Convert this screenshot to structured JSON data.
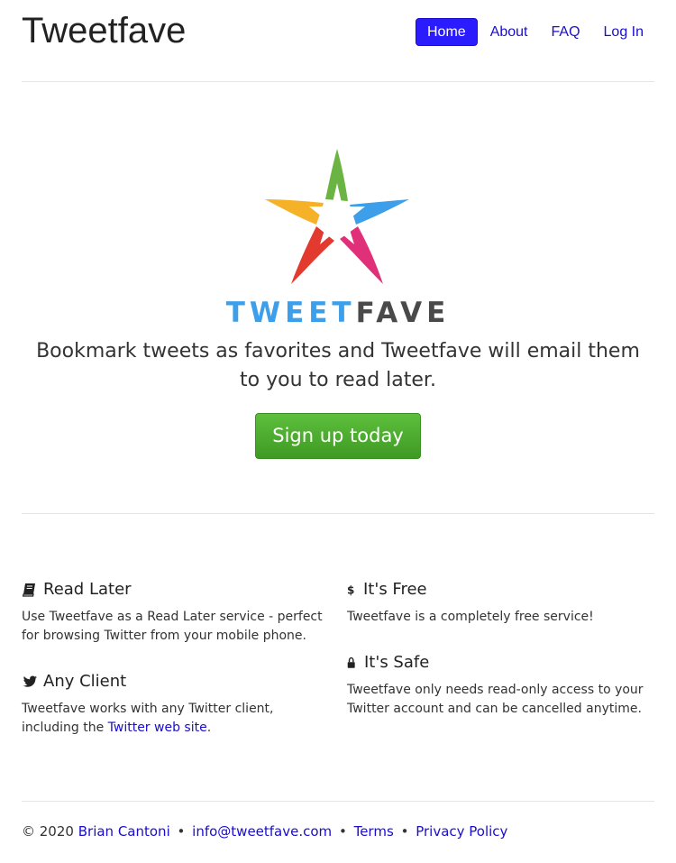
{
  "header": {
    "brand": "Tweetfave",
    "nav": [
      {
        "label": "Home",
        "active": true
      },
      {
        "label": "About",
        "active": false
      },
      {
        "label": "FAQ",
        "active": false
      },
      {
        "label": "Log In",
        "active": false
      }
    ]
  },
  "hero": {
    "logo_icon": "multicolor-star-icon",
    "wordmark_part1": "TWEET",
    "wordmark_part2": "FAVE",
    "tagline": "Bookmark tweets as favorites and Tweetfave will email them to you to read later.",
    "cta_label": "Sign up today"
  },
  "features": {
    "read_later": {
      "icon": "book-icon",
      "title": "Read Later",
      "text": "Use Tweetfave as a Read Later service - perfect for browsing Twitter from your mobile phone."
    },
    "any_client": {
      "icon": "twitter-bird-icon",
      "title": "Any Client",
      "text_before": "Tweetfave works with any Twitter client, including the ",
      "link": "Twitter web site",
      "text_after": "."
    },
    "free": {
      "icon": "dollar-icon",
      "title": "It's Free",
      "text": "Tweetfave is a completely free service!"
    },
    "safe": {
      "icon": "lock-icon",
      "title": "It's Safe",
      "text": "Tweetfave only needs read-only access to your Twitter account and can be cancelled anytime."
    }
  },
  "footer": {
    "copyright": "© 2020",
    "author": "Brian Cantoni",
    "email": "info@tweetfave.com",
    "terms": "Terms",
    "privacy": "Privacy Policy",
    "separator": "•"
  },
  "colors": {
    "link": "#1a0dcc",
    "nav_active_bg": "#2b1cff",
    "cta_green": "#4caf30",
    "wordmark_blue": "#3d9fea",
    "wordmark_gray": "#4a4a4a"
  }
}
